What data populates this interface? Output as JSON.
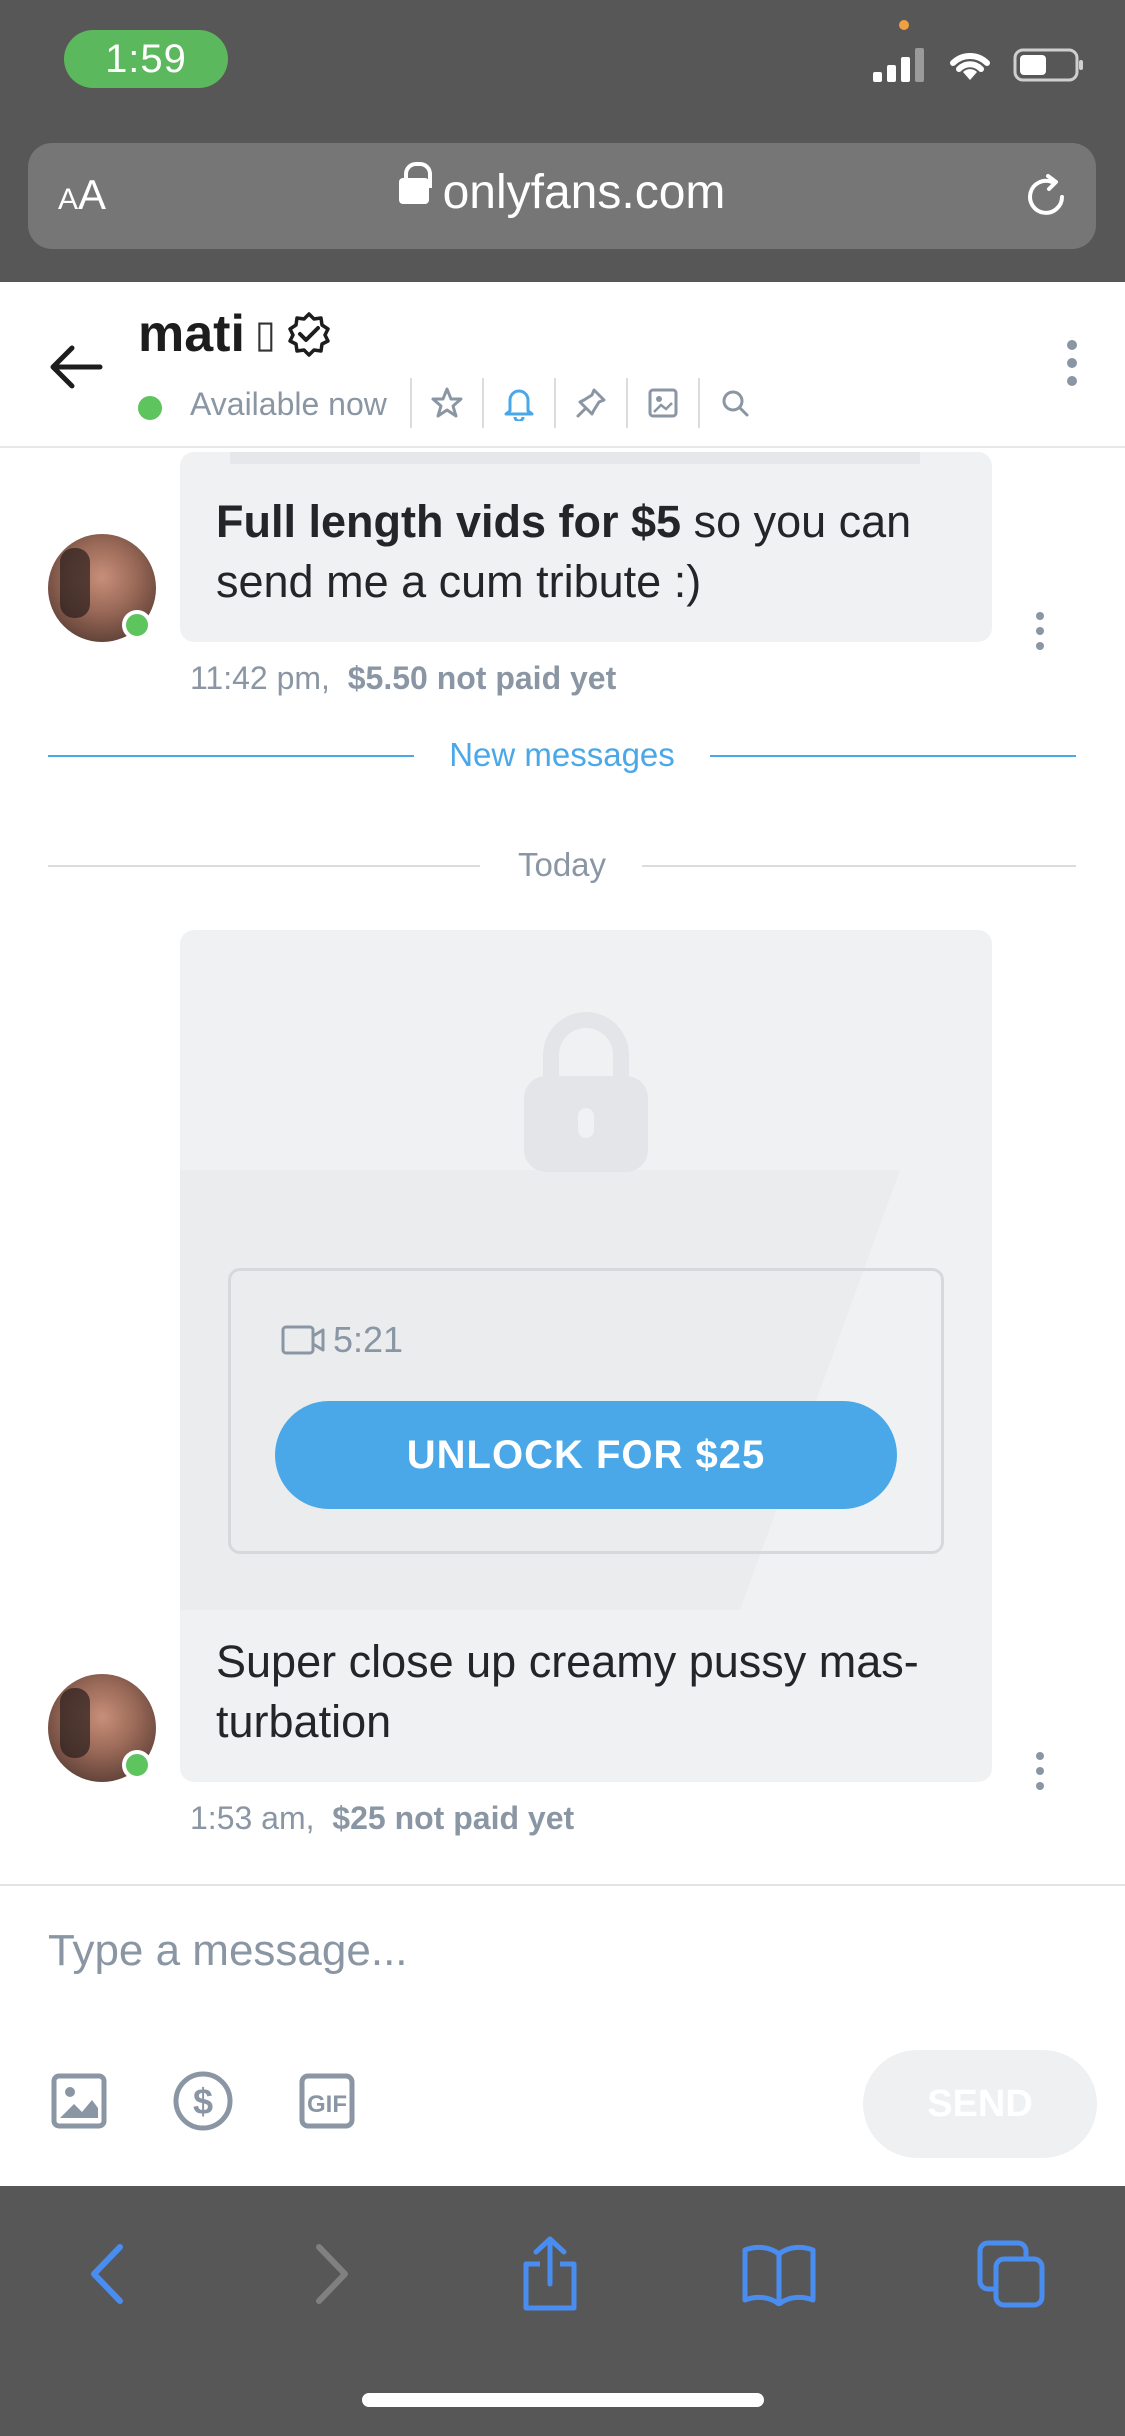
{
  "status": {
    "time": "1:59"
  },
  "browser": {
    "aa_small": "A",
    "aa_large": "A",
    "url": "onlyfans.com"
  },
  "chat": {
    "name": "mati",
    "name_glyph": "▯",
    "status": "Available now"
  },
  "messages": [
    {
      "bold": "Full length vids for $5",
      "text": " so you can send me a cum tribute :)",
      "time": "11:42 pm,",
      "price_status": "$5.50 not paid yet"
    },
    {
      "duration": "5:21",
      "unlock_label": "UNLOCK FOR $25",
      "text": "Super close up creamy pussy mas-\nturbation",
      "time": "1:53 am,",
      "price_status": "$25 not paid yet"
    }
  ],
  "dividers": {
    "new": "New messages",
    "today": "Today"
  },
  "composer": {
    "placeholder": "Type a message...",
    "send_label": "SEND"
  },
  "colors": {
    "accent": "#4aa8e8",
    "online": "#5ec45e",
    "chrome": "#575757"
  }
}
